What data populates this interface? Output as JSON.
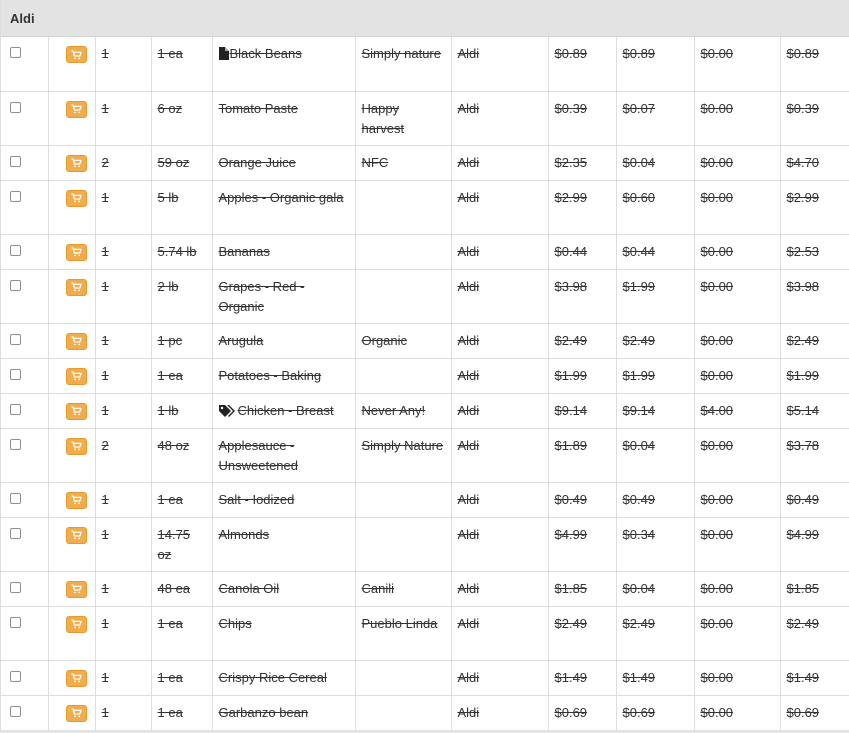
{
  "store": {
    "name": "Aldi"
  },
  "colors": {
    "cart_button": "#f0ad4e",
    "header_bg": "#e3e3e3"
  },
  "items": [
    {
      "qty": "1",
      "size": "1 ea",
      "name": "Black Beans",
      "icon": "document-icon",
      "brand": "Simply nature",
      "store": "Aldi",
      "price": "$0.89",
      "unit_price": "$0.89",
      "discount": "$0.00",
      "total": "$0.89"
    },
    {
      "qty": "1",
      "size": "6 oz",
      "name": "Tomato Paste",
      "icon": "",
      "brand": "Happy harvest",
      "store": "Aldi",
      "price": "$0.39",
      "unit_price": "$0.07",
      "discount": "$0.00",
      "total": "$0.39"
    },
    {
      "qty": "2",
      "size": "59 oz",
      "name": "Orange Juice",
      "icon": "",
      "brand": "NFC",
      "store": "Aldi",
      "price": "$2.35",
      "unit_price": "$0.04",
      "discount": "$0.00",
      "total": "$4.70"
    },
    {
      "qty": "1",
      "size": "5 lb",
      "name": "Apples - Organic gala",
      "icon": "",
      "brand": "",
      "store": "Aldi",
      "price": "$2.99",
      "unit_price": "$0.60",
      "discount": "$0.00",
      "total": "$2.99"
    },
    {
      "qty": "1",
      "size": "5.74 lb",
      "name": "Bananas",
      "icon": "",
      "brand": "",
      "store": "Aldi",
      "price": "$0.44",
      "unit_price": "$0.44",
      "discount": "$0.00",
      "total": "$2.53"
    },
    {
      "qty": "1",
      "size": "2 lb",
      "name": "Grapes - Red - Organic",
      "icon": "",
      "brand": "",
      "store": "Aldi",
      "price": "$3.98",
      "unit_price": "$1.99",
      "discount": "$0.00",
      "total": "$3.98"
    },
    {
      "qty": "1",
      "size": "1 pc",
      "name": "Arugula",
      "icon": "",
      "brand": "Organic",
      "store": "Aldi",
      "price": "$2.49",
      "unit_price": "$2.49",
      "discount": "$0.00",
      "total": "$2.49"
    },
    {
      "qty": "1",
      "size": "1 ea",
      "name": "Potatoes - Baking",
      "icon": "",
      "brand": "",
      "store": "Aldi",
      "price": "$1.99",
      "unit_price": "$1.99",
      "discount": "$0.00",
      "total": "$1.99"
    },
    {
      "qty": "1",
      "size": "1 lb",
      "name": "Chicken - Breast",
      "icon": "tags-icon",
      "brand": "Never Any!",
      "store": "Aldi",
      "price": "$9.14",
      "unit_price": "$9.14",
      "discount": "$4.00",
      "total": "$5.14"
    },
    {
      "qty": "2",
      "size": "48 oz",
      "name": "Applesauce - Unsweetened",
      "icon": "",
      "brand": "Simply Nature",
      "store": "Aldi",
      "price": "$1.89",
      "unit_price": "$0.04",
      "discount": "$0.00",
      "total": "$3.78"
    },
    {
      "qty": "1",
      "size": "1 ea",
      "name": "Salt - Iodized",
      "icon": "",
      "brand": "",
      "store": "Aldi",
      "price": "$0.49",
      "unit_price": "$0.49",
      "discount": "$0.00",
      "total": "$0.49"
    },
    {
      "qty": "1",
      "size": "14.75 oz",
      "name": "Almonds",
      "icon": "",
      "brand": "",
      "store": "Aldi",
      "price": "$4.99",
      "unit_price": "$0.34",
      "discount": "$0.00",
      "total": "$4.99"
    },
    {
      "qty": "1",
      "size": "48 ea",
      "name": "Canola Oil",
      "icon": "",
      "brand": "Canili",
      "store": "Aldi",
      "price": "$1.85",
      "unit_price": "$0.04",
      "discount": "$0.00",
      "total": "$1.85"
    },
    {
      "qty": "1",
      "size": "1 ea",
      "name": "Chips",
      "icon": "",
      "brand": "Pueblo Linda",
      "store": "Aldi",
      "price": "$2.49",
      "unit_price": "$2.49",
      "discount": "$0.00",
      "total": "$2.49"
    },
    {
      "qty": "1",
      "size": "1 ea",
      "name": "Crispy Rice Cereal",
      "icon": "",
      "brand": "",
      "store": "Aldi",
      "price": "$1.49",
      "unit_price": "$1.49",
      "discount": "$0.00",
      "total": "$1.49"
    },
    {
      "qty": "1",
      "size": "1 ea",
      "name": "Garbanzo bean",
      "icon": "",
      "brand": "",
      "store": "Aldi",
      "price": "$0.69",
      "unit_price": "$0.69",
      "discount": "$0.00",
      "total": "$0.69"
    }
  ]
}
